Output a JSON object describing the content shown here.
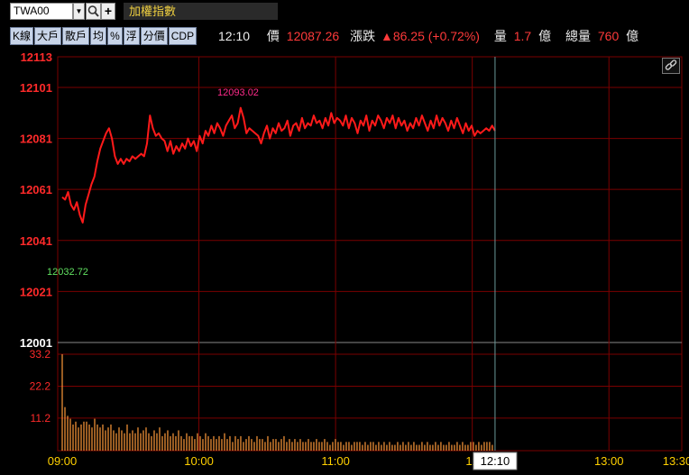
{
  "toolbar": {
    "symbol": "TWA00",
    "dropdown_glyph": "▼",
    "add_glyph": "+",
    "instrument_name": "加權指數",
    "buttons": [
      "K線",
      "大戶",
      "散戶",
      "均",
      "%",
      "浮",
      "分價",
      "CDP"
    ]
  },
  "quote": {
    "time": "12:10",
    "price_label": "價",
    "price": "12087.26",
    "change_label": "漲跌",
    "change": "▲86.25 (+0.72%)",
    "volume_label": "量",
    "volume": "1.7",
    "volume_unit": "億",
    "total_volume_label": "總量",
    "total_volume": "760",
    "total_volume_unit": "億"
  },
  "colors": {
    "price_line": "#ff1a1a",
    "grid": "#7a0000",
    "axis_text": "#ff2a2a",
    "time_text": "#ffd000",
    "volume_bar": "#ff9a3a",
    "cursor": "#6a9a9a",
    "high_label": "#ff2a8a",
    "low_label": "#60e060"
  },
  "icons": {
    "search": "magnifier-icon",
    "link": "link-icon"
  },
  "chart_data": [
    {
      "type": "line",
      "title": "",
      "price_axis_ticks": [
        12113,
        12101,
        12081,
        12061,
        12041,
        12021,
        12001
      ],
      "price_axis_reference": 12001,
      "ylim": [
        12001,
        12113
      ],
      "time_axis_ticks": [
        "09:00",
        "10:00",
        "11:00",
        "12",
        "13:00",
        "13:30"
      ],
      "cursor_label": "12:10",
      "high_label": "12093.02",
      "low_label": "12032.72",
      "x_start_minutes": 0,
      "x_end_minutes": 270,
      "series": [
        {
          "values": [
            12058,
            12057,
            12060,
            12055,
            12053,
            12056,
            12051,
            12048,
            12055,
            12059,
            12063,
            12066,
            12072,
            12077,
            12080,
            12083,
            12085,
            12081,
            12074,
            12071,
            12073,
            12071,
            12073,
            12072,
            12074,
            12073,
            12074,
            12075,
            12074,
            12079,
            12090,
            12085,
            12082,
            12083,
            12081,
            12080,
            12076,
            12080,
            12075,
            12078,
            12076,
            12079,
            12077,
            12081,
            12078,
            12080,
            12076,
            12082,
            12079,
            12084,
            12082,
            12086,
            12083,
            12087,
            12085,
            12082,
            12086,
            12088,
            12090,
            12085,
            12087,
            12093,
            12089,
            12083,
            12085,
            12084,
            12083,
            12082,
            12079,
            12083,
            12086,
            12081,
            12085,
            12083,
            12087,
            12084,
            12085,
            12088,
            12082,
            12086,
            12087,
            12084,
            12089,
            12085,
            12087,
            12086,
            12090,
            12087,
            12088,
            12085,
            12089,
            12086,
            12091,
            12087,
            12089,
            12088,
            12086,
            12090,
            12085,
            12089,
            12087,
            12083,
            12088,
            12086,
            12090,
            12084,
            12088,
            12086,
            12090,
            12088,
            12085,
            12089,
            12087,
            12090,
            12085,
            12089,
            12086,
            12088,
            12084,
            12087,
            12085,
            12089,
            12086,
            12090,
            12087,
            12084,
            12088,
            12085,
            12090,
            12086,
            12089,
            12087,
            12084,
            12088,
            12085,
            12089,
            12086,
            12083,
            12087,
            12084,
            12086,
            12082,
            12084,
            12083,
            12084,
            12085,
            12084,
            12086,
            12084
          ]
        }
      ]
    },
    {
      "type": "bar",
      "title": "",
      "volume_axis_ticks": [
        33.2,
        22.2,
        11.2
      ],
      "ylim": [
        0,
        36
      ],
      "values": [
        33.2,
        15,
        12,
        11,
        9,
        10,
        8,
        9,
        10,
        10,
        9,
        8,
        11,
        9,
        8,
        9,
        7,
        8,
        9,
        7,
        6,
        8,
        7,
        6,
        9,
        6,
        7,
        6,
        8,
        6,
        7,
        8,
        6,
        5,
        7,
        6,
        8,
        5,
        6,
        7,
        5,
        6,
        5,
        7,
        5,
        4,
        6,
        5,
        5,
        4,
        6,
        5,
        4,
        6,
        5,
        4,
        5,
        4,
        5,
        4,
        6,
        4,
        5,
        3,
        5,
        4,
        5,
        3,
        4,
        5,
        4,
        3,
        5,
        4,
        4,
        3,
        5,
        3,
        4,
        4,
        3,
        4,
        5,
        3,
        4,
        3,
        4,
        3,
        4,
        3,
        3,
        4,
        3,
        3,
        4,
        3,
        3,
        4,
        3,
        2,
        3,
        4,
        3,
        3,
        2,
        3,
        3,
        2,
        3,
        3,
        3,
        2,
        3,
        2,
        3,
        3,
        2,
        3,
        2,
        3,
        2,
        3,
        2,
        2,
        3,
        2,
        3,
        2,
        3,
        2,
        3,
        2,
        2,
        3,
        2,
        3,
        2,
        2,
        3,
        2,
        3,
        2,
        2,
        3,
        2,
        2,
        3,
        2,
        3,
        2,
        2,
        3,
        3,
        2,
        3,
        2,
        3,
        3,
        3,
        2
      ]
    }
  ]
}
